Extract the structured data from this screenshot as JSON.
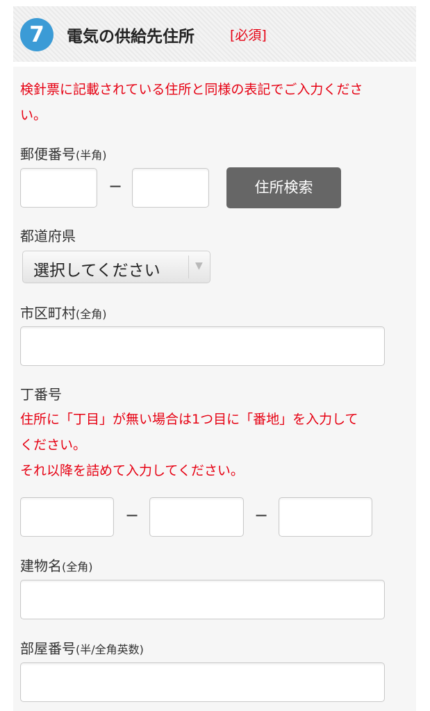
{
  "header": {
    "step_number": "7",
    "title": "電気の供給先住所",
    "required": "[必須]"
  },
  "instructions": {
    "line1": "検針票に記載されている住所と同様の表記でご入力くださ",
    "line2": "い。"
  },
  "postal": {
    "label": "郵便番号",
    "label_note": "(半角)",
    "separator": "−",
    "search_button": "住所検索"
  },
  "prefecture": {
    "label": "都道府県",
    "selected": "選択してください"
  },
  "city": {
    "label": "市区町村",
    "label_note": "(全角)"
  },
  "block": {
    "label": "丁番号",
    "note_line1": "住所に「丁目」が無い場合は1つ目に「番地」を入力して",
    "note_line2": "ください。",
    "note_line3": "それ以降を詰めて入力してください。",
    "separator": "−"
  },
  "building": {
    "label": "建物名",
    "label_note": "(全角)"
  },
  "room": {
    "label": "部屋番号",
    "label_note": "(半/全角英数)"
  },
  "colors": {
    "accent_blue": "#3b9bd6",
    "required_red": "#e60012",
    "button_gray": "#666666"
  },
  "icons": {
    "select_arrow": "triangle-down-icon"
  }
}
